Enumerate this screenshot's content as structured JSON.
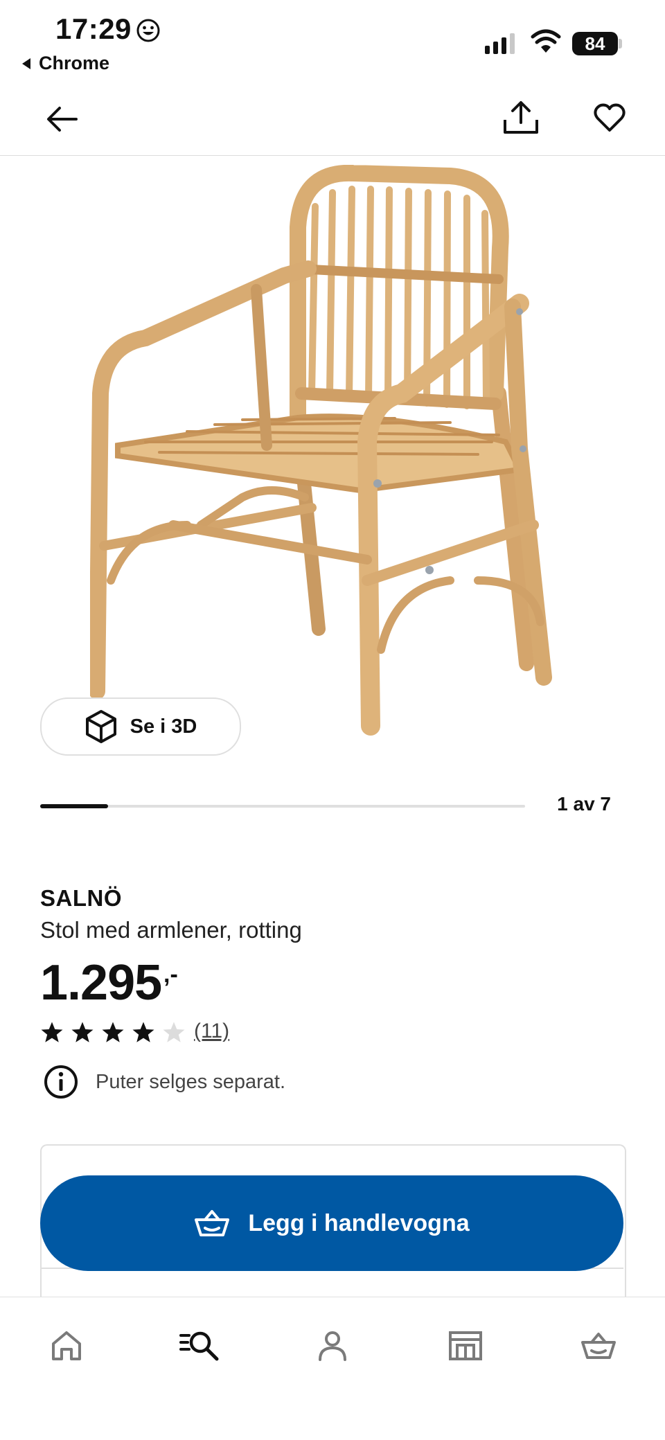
{
  "status_bar": {
    "time": "17:29",
    "back_app": "Chrome",
    "battery": "84"
  },
  "header": {
    "back_icon": "arrow-left-icon",
    "share_icon": "share-icon",
    "favorite_icon": "heart-icon"
  },
  "gallery": {
    "view_3d_label": "Se i 3D",
    "page_indicator": "1 av 7",
    "progress": 0.14
  },
  "product": {
    "name": "SALNÖ",
    "description": "Stol med armlener, rotting",
    "price": "1.295",
    "price_suffix": ",-",
    "rating": 4,
    "rating_max": 5,
    "reviews": "(11)",
    "info_text": "Puter selges separat."
  },
  "actions": {
    "add_to_cart_label": "Legg i handlevogna"
  },
  "bottom_nav": {
    "items": [
      "home-icon",
      "search-icon",
      "profile-icon",
      "store-icon",
      "cart-icon"
    ]
  },
  "colors": {
    "primary": "#0058a3",
    "text": "#111111"
  }
}
